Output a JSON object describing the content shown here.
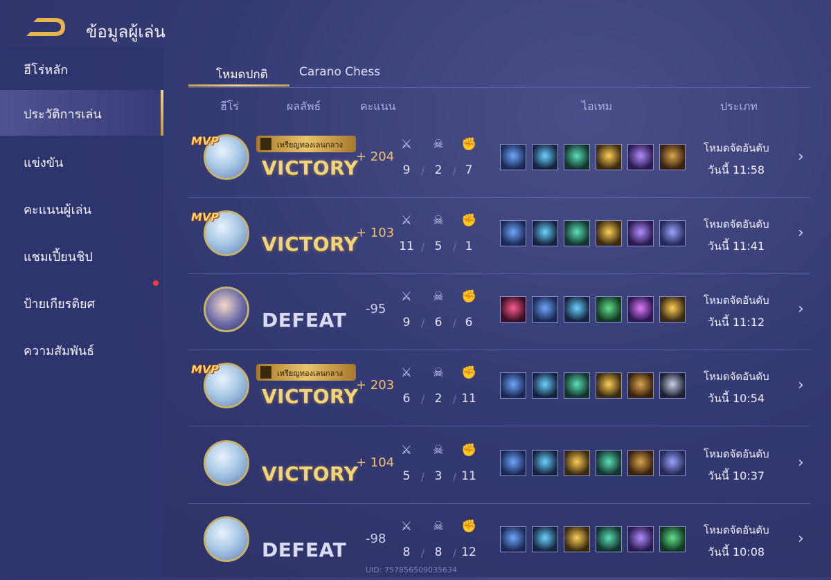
{
  "header": {
    "title": "ข้อมูลผู้เล่น"
  },
  "sidebar": {
    "items": [
      {
        "label": "ฮีโร่หลัก",
        "active": false
      },
      {
        "label": "ประวัติการเล่น",
        "active": true
      },
      {
        "label": "แข่งขัน",
        "active": false
      },
      {
        "label": "คะแนนผู้เล่น",
        "active": false
      },
      {
        "label": "แชมเปี้ยนชิป",
        "active": false
      },
      {
        "label": "ป้ายเกียรติยศ",
        "active": false
      },
      {
        "label": "ความสัมพันธ์",
        "active": false
      }
    ]
  },
  "tabs": [
    {
      "label": "โหมดปกติ",
      "active": true
    },
    {
      "label": "Carano Chess",
      "active": false
    }
  ],
  "columns": {
    "hero": "ฮีโร่",
    "result": "ผลลัพธ์",
    "score": "คะแนน",
    "items": "ไอเทม",
    "type": "ประเภท"
  },
  "matches": [
    {
      "mvp": "MVP",
      "medal": "เหรียญทองเลนกลาง",
      "result": "VICTORY",
      "score": "+ 204",
      "kills": "9",
      "deaths": "2",
      "assists": "7",
      "items": [
        "boots-icon",
        "potion-icon",
        "sword-icon",
        "crown-icon",
        "blade-icon",
        "book-icon"
      ],
      "mode": "โหมดจัดอันดับ",
      "time": "วันนี้ 11:58"
    },
    {
      "mvp": "MVP",
      "medal": "",
      "result": "VICTORY",
      "score": "+ 103",
      "kills": "11",
      "deaths": "5",
      "assists": "1",
      "items": [
        "boots-icon",
        "potion-icon",
        "sword-icon",
        "crown-icon",
        "blade-icon",
        "tome-icon"
      ],
      "mode": "โหมดจัดอันดับ",
      "time": "วันนี้ 11:41"
    },
    {
      "mvp": "",
      "medal": "",
      "result": "DEFEAT",
      "score": "-95",
      "kills": "9",
      "deaths": "6",
      "assists": "6",
      "items": [
        "rune-icon",
        "boots-icon",
        "potion-icon",
        "spellbook-icon",
        "orb-icon",
        "crown-icon"
      ],
      "mode": "โหมดจัดอันดับ",
      "time": "วันนี้ 11:12"
    },
    {
      "mvp": "MVP",
      "medal": "เหรียญทองเลนกลาง",
      "result": "VICTORY",
      "score": "+ 203",
      "kills": "6",
      "deaths": "2",
      "assists": "11",
      "items": [
        "boots-icon",
        "potion-icon",
        "sword-icon",
        "crown-icon",
        "book-icon",
        "dagger-icon"
      ],
      "mode": "โหมดจัดอันดับ",
      "time": "วันนี้ 10:54"
    },
    {
      "mvp": "",
      "medal": "",
      "result": "VICTORY",
      "score": "+ 104",
      "kills": "5",
      "deaths": "3",
      "assists": "11",
      "items": [
        "boots-icon",
        "potion-icon",
        "crown-icon",
        "sword-icon",
        "book-icon",
        "tome-icon"
      ],
      "mode": "โหมดจัดอันดับ",
      "time": "วันนี้ 10:37"
    },
    {
      "mvp": "",
      "medal": "",
      "result": "DEFEAT",
      "score": "-98",
      "kills": "8",
      "deaths": "8",
      "assists": "12",
      "items": [
        "boots-icon",
        "potion-icon",
        "crown-icon",
        "sword-icon",
        "blade-icon",
        "spellbook-icon"
      ],
      "mode": "โหมดจัดอันดับ",
      "time": "วันนี้ 10:08"
    }
  ],
  "uid": "UID: 757856509035634"
}
